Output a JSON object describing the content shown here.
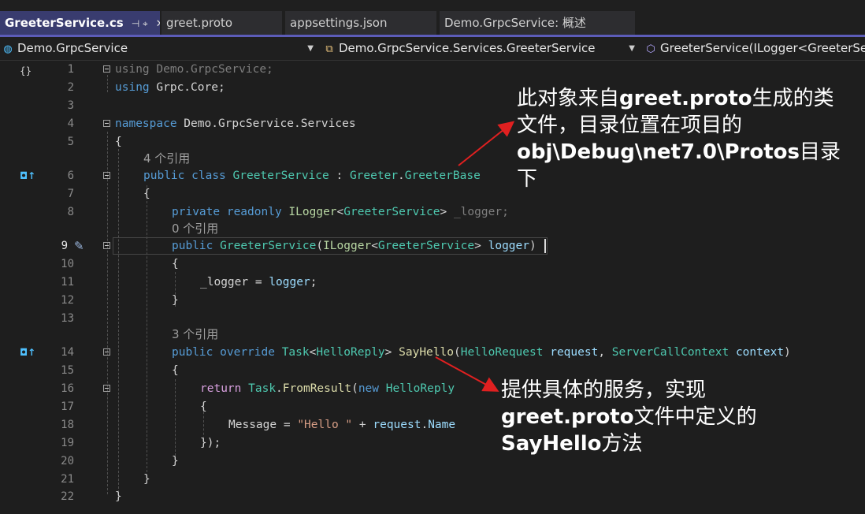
{
  "tabs": [
    {
      "label": "GreeterService.cs",
      "pin": "⊣ ⌖",
      "close": "✕"
    },
    {
      "label": "greet.proto"
    },
    {
      "label": "appsettings.json"
    },
    {
      "label": "Demo.GrpcService: 概述"
    }
  ],
  "navbar": {
    "project": "Demo.GrpcService",
    "class": "Demo.GrpcService.Services.GreeterService",
    "member": "GreeterService(ILogger<GreeterSe"
  },
  "editor": {
    "line_numbers": [
      "1",
      "2",
      "3",
      "4",
      "5",
      "6",
      "7",
      "8",
      "9",
      "10",
      "11",
      "12",
      "13",
      "14",
      "15",
      "16",
      "17",
      "18",
      "19",
      "20",
      "21",
      "22"
    ],
    "code": {
      "l1": [
        "using",
        " Demo.GrpcService;"
      ],
      "l2": [
        "using",
        " Grpc.Core;"
      ],
      "l4": [
        "namespace",
        " Demo.GrpcService.Services"
      ],
      "l5": "{",
      "lens6": "4 个引用",
      "l6": [
        "public",
        " ",
        "class",
        " ",
        "GreeterService",
        " : ",
        "Greeter",
        ".",
        "GreeterBase"
      ],
      "l7": "{",
      "l8": [
        "private",
        " ",
        "readonly",
        " ",
        "ILogger",
        "<",
        "GreeterService",
        "> ",
        "_logger",
        ";"
      ],
      "lens9": "0 个引用",
      "l9": [
        "public",
        " ",
        "GreeterService",
        "(",
        "ILogger",
        "<",
        "GreeterService",
        "> ",
        "logger",
        ")"
      ],
      "l10": "{",
      "l11": [
        "_logger",
        " = ",
        "logger",
        ";"
      ],
      "l12": "}",
      "lens14": "3 个引用",
      "l14": [
        "public",
        " ",
        "override",
        " ",
        "Task",
        "<",
        "HelloReply",
        "> ",
        "SayHello",
        "(",
        "HelloRequest",
        " ",
        "request",
        ", ",
        "ServerCallContext",
        " ",
        "context",
        ")"
      ],
      "l15": "{",
      "l16": [
        "return",
        " ",
        "Task",
        ".",
        "FromResult",
        "(",
        "new",
        " ",
        "HelloReply"
      ],
      "l17": "{",
      "l18": [
        "Message",
        " = ",
        "\"Hello \"",
        " + ",
        "request",
        ".",
        "Name"
      ],
      "l19": "});",
      "l20": "}",
      "l21": "}",
      "l22": "}"
    }
  },
  "annotations": {
    "top": {
      "part1": "此对象来自",
      "bold1": "greet.proto",
      "part2": "生成的类\n文件，目录位置在项目的\n",
      "bold2": "obj\\Debug\\net7.0\\Protos",
      "part3": "目录\n下"
    },
    "bottom": {
      "part1": "提供具体的服务，实现\n",
      "bold1": "greet.proto",
      "part2": "文件中定义的\n",
      "bold2": "SayHello",
      "part3": "方法"
    }
  },
  "colors": {
    "arrow": "#e02020",
    "tab_active": "#393c6f",
    "keyword": "#569cd6",
    "type": "#4ec9b0",
    "method": "#dcdcaa",
    "param": "#9cdcfe"
  }
}
